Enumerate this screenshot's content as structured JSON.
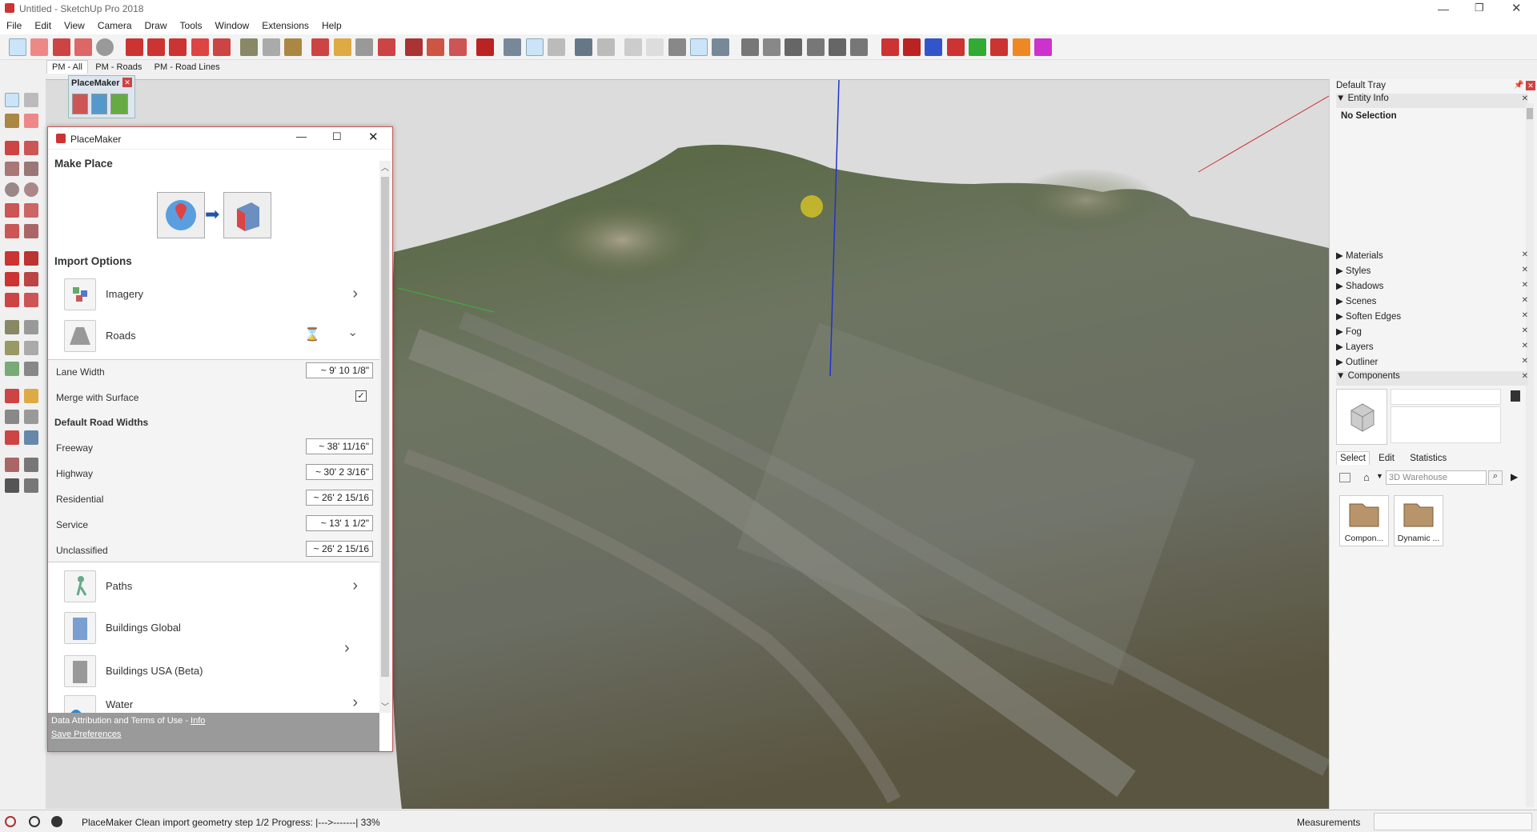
{
  "window": {
    "title": "Untitled - SketchUp Pro 2018"
  },
  "menu": [
    "File",
    "Edit",
    "View",
    "Camera",
    "Draw",
    "Tools",
    "Window",
    "Extensions",
    "Help"
  ],
  "scene_tabs": [
    "PM - All",
    "PM - Roads",
    "PM - Road Lines"
  ],
  "placemaker_toolbar": {
    "title": "PlaceMaker"
  },
  "placemaker_window": {
    "title": "PlaceMaker",
    "make_place": "Make Place",
    "import_options": "Import Options",
    "options": {
      "imagery": "Imagery",
      "roads": "Roads",
      "paths": "Paths",
      "buildings_global": "Buildings Global",
      "buildings_usa": "Buildings USA (Beta)",
      "water": "Water"
    },
    "roads": {
      "lane_width_label": "Lane Width",
      "lane_width_value": "~ 9' 10 1/8\"",
      "merge_label": "Merge with Surface",
      "merge_checked": true,
      "default_widths_title": "Default Road Widths",
      "freeway_label": "Freeway",
      "freeway_value": "~ 38' 11/16\"",
      "highway_label": "Highway",
      "highway_value": "~ 30' 2 3/16\"",
      "residential_label": "Residential",
      "residential_value": "~ 26' 2 15/16",
      "service_label": "Service",
      "service_value": "~ 13' 1 1/2\"",
      "unclassified_label": "Unclassified",
      "unclassified_value": "~ 26' 2 15/16"
    },
    "footer": {
      "attribution": "Data Attribution and Terms of Use - ",
      "info_link": "Info",
      "save_prefs": "Save Preferences"
    }
  },
  "tray": {
    "title": "Default Tray",
    "entity_info": "Entity Info",
    "no_selection": "No Selection",
    "panels": [
      "Materials",
      "Styles",
      "Shadows",
      "Scenes",
      "Soften Edges",
      "Fog",
      "Layers",
      "Outliner",
      "Components"
    ],
    "components": {
      "tabs": [
        "Select",
        "Edit",
        "Statistics"
      ],
      "search_placeholder": "3D Warehouse",
      "items": [
        "Compon...",
        "Dynamic ..."
      ]
    }
  },
  "status": {
    "message": "PlaceMaker Clean import geometry step 1/2 Progress: |--->-------| 33%",
    "measurements_label": "Measurements"
  },
  "colors": {
    "accent_red": "#cc3333",
    "selection_blue": "#cce4f7",
    "link_blue": "#1a5aa8"
  }
}
